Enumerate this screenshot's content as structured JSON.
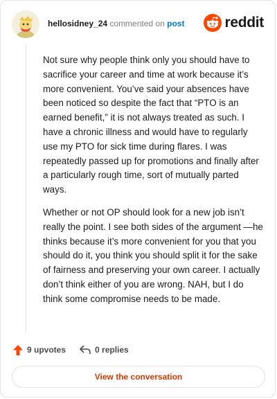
{
  "comment": {
    "username": "hellosidney_24",
    "action_text": "commented on",
    "target_link": "post",
    "paragraphs": [
      "Not sure why people think only you should have to sacrifice your career and time at work because it’s more convenient. You’ve said your absences have been noticed so despite the fact that “PTO is an earned benefit,” it is not always treated as such. I have a chronic illness and would have to regularly use my PTO for sick time during flares. I was repeatedly passed up for promotions and finally after a particularly rough time, sort of mutually parted ways.",
      "Whether or not OP should look for a new job isn’t really the point. I see both sides of the argument —he thinks because it’s more convenient for you that you should do it, you think you should split it for the sake of fairness and preserving your own career. I actually don’t think either of you are wrong. NAH, but I do think some compromise needs to be made."
    ]
  },
  "brand": {
    "wordmark": "reddit",
    "color": "#ff4500",
    "logo_icon": "reddit-snoo-icon"
  },
  "actions": {
    "upvotes": "9 upvotes",
    "upvote_icon": "upvote-arrow-icon",
    "upvote_color": "#ff4500",
    "replies": "0 replies",
    "reply_icon": "reply-arrow-icon"
  },
  "cta": {
    "label": "View the conversation",
    "color": "#d93a00"
  }
}
